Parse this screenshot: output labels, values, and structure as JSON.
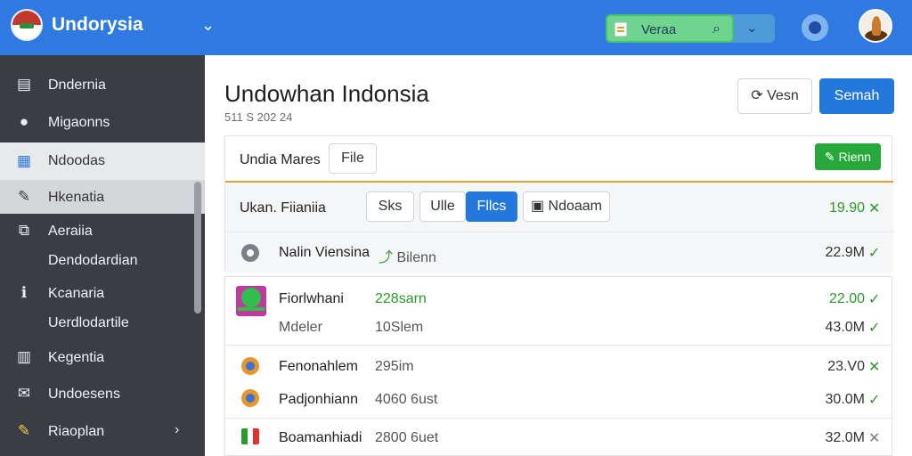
{
  "app": {
    "name": "Undorysia",
    "search_value": "Veraa"
  },
  "icons": {
    "menu": "chevron-down-icon",
    "search": "search-icon",
    "settings": "gear-icon",
    "profile": "avatar"
  },
  "sidebar": {
    "items": [
      {
        "label": "Dndernia",
        "icon": "window-icon"
      },
      {
        "label": "Migaonns",
        "icon": "user-icon"
      },
      {
        "label": "Ndoodas",
        "icon": "calendar-icon"
      },
      {
        "label": "Hkenatia",
        "icon": "pin-icon"
      },
      {
        "label": "Aeraiia",
        "icon": "puzzle-icon",
        "sub": "Dendodardian"
      },
      {
        "label": "Kcanaria",
        "icon": "info-icon",
        "sub": "Uerdlodartile"
      },
      {
        "label": "Kegentia",
        "icon": "document-icon"
      },
      {
        "label": "Undoesens",
        "icon": "mail-icon"
      },
      {
        "label": "Riaoplan",
        "icon": "tag-icon"
      }
    ]
  },
  "main": {
    "title": "Undowhan Indonsia",
    "subtitle": "511 S 202 24",
    "view_button": "Vesn",
    "search_button": "Semah",
    "toolbar": {
      "label": "Undia Mares",
      "file_button": "File",
      "edit_button": "Rienn"
    },
    "filter": {
      "label": "Ukan.",
      "label_strong": "Fiianiia",
      "chips": [
        "Sks",
        "Ulle",
        "Fllcs",
        "Ndoaam"
      ],
      "selected_chip": "Fllcs",
      "value": "19.90"
    },
    "summary": {
      "label": "Nalin Viensina",
      "tag": "Bilenn",
      "value": "22.9M"
    },
    "rows": [
      {
        "name": "Fiorlwhani",
        "detail": "228sarn",
        "value": "22.00"
      },
      {
        "name": "Mdeler",
        "detail": "10Slem",
        "value": "43.0M"
      },
      {
        "name": "Fenonahlem",
        "detail": "295im",
        "value": "23.V0"
      },
      {
        "name": "Padjonhiann",
        "detail": "4060 6ust",
        "value": "30.0M"
      },
      {
        "name": "Boamanhiadi",
        "detail": "2800 6uet",
        "value": "32.0M"
      }
    ]
  },
  "colors": {
    "topbar": "#2f7ae0",
    "sidebar": "#3a3d44",
    "accent": "#2478dc",
    "success": "#2a9b2a"
  }
}
